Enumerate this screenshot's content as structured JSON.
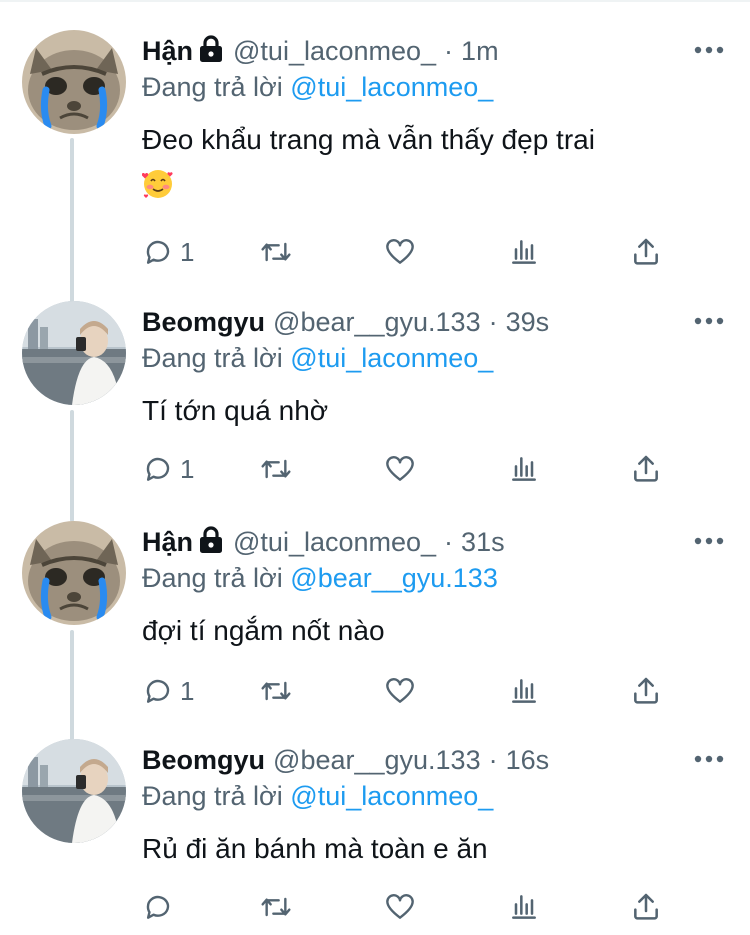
{
  "reply_prefix": "Đang trả lời",
  "colors": {
    "link": "#1d9bf0",
    "muted": "#536471",
    "text": "#0f1419",
    "thread_line": "#cfd9de"
  },
  "tweets": [
    {
      "name": "Hận",
      "locked": true,
      "handle": "@tui_laconmeo_",
      "dot": "·",
      "time": "1m",
      "reply_to": "@tui_laconmeo_",
      "text": "Đeo khẩu trang mà vẫn thấy đẹp trai",
      "emoji": "smiling-face-with-hearts",
      "actions": {
        "reply_count": "1",
        "retweet_count": "",
        "like_count": "",
        "views_count": ""
      }
    },
    {
      "name": "Beomgyu",
      "locked": false,
      "handle": "@bear__gyu.133",
      "dot": "·",
      "time": "39s",
      "reply_to": "@tui_laconmeo_",
      "text": "Tí tớn quá nhờ",
      "actions": {
        "reply_count": "1",
        "retweet_count": "",
        "like_count": "",
        "views_count": ""
      }
    },
    {
      "name": "Hận",
      "locked": true,
      "handle": "@tui_laconmeo_",
      "dot": "·",
      "time": "31s",
      "reply_to": "@bear__gyu.133",
      "text": "đợi tí ngắm nốt nào",
      "actions": {
        "reply_count": "1",
        "retweet_count": "",
        "like_count": "",
        "views_count": ""
      }
    },
    {
      "name": "Beomgyu",
      "locked": false,
      "handle": "@bear__gyu.133",
      "dot": "·",
      "time": "16s",
      "reply_to": "@tui_laconmeo_",
      "text": "Rủ đi ăn bánh mà toàn e ăn",
      "actions": {
        "reply_count": "",
        "retweet_count": "",
        "like_count": "",
        "views_count": ""
      }
    }
  ]
}
